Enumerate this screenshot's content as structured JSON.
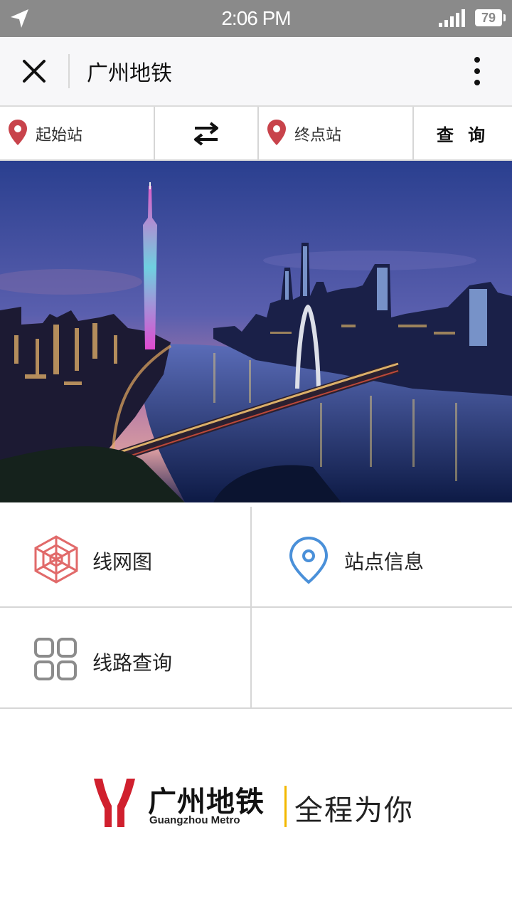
{
  "status_bar": {
    "time": "2:06 PM",
    "battery": "79"
  },
  "title_bar": {
    "title": "广州地铁"
  },
  "query_bar": {
    "start_label": "起始站",
    "end_label": "终点站",
    "query_label": "查 询"
  },
  "menu": {
    "items": [
      {
        "label": "线网图",
        "icon": "network-map-icon"
      },
      {
        "label": "站点信息",
        "icon": "location-pin-icon"
      },
      {
        "label": "线路查询",
        "icon": "grid-icon"
      }
    ]
  },
  "logo": {
    "name_cn": "广州地铁",
    "name_en": "Guangzhou Metro",
    "slogan": "全程为你"
  },
  "colors": {
    "status_bar_bg": "#8a8a8a",
    "title_bar_bg": "#f7f7f9",
    "pin_red": "#c8434b",
    "network_icon_red": "#e16a6a",
    "info_icon_blue": "#4a90d9",
    "brand_red": "#d0202e",
    "slogan_yellow": "#f3b800"
  }
}
